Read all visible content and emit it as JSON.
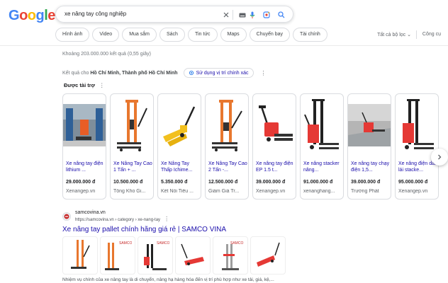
{
  "logo": {
    "text": "Google",
    "letters": [
      "G",
      "o",
      "o",
      "g",
      "l",
      "e"
    ]
  },
  "search": {
    "query": "xe nâng tay công nghiệp"
  },
  "chips": [
    "Hình ảnh",
    "Video",
    "Mua sắm",
    "Sách",
    "Tin tức",
    "Maps",
    "Chuyến bay",
    "Tài chính"
  ],
  "filters_label": "Tất cả bộ lọc",
  "tools_label": "Công cụ",
  "stats": "Khoảng 203.000.000 kết quả (0,55 giây)",
  "location": {
    "prefix": "Kết quả cho",
    "place": "Hồ Chí Minh, Thành phố Hồ Chí Minh",
    "button": "Sử dụng vị trí chính xác"
  },
  "sponsored": {
    "label": "Được tài trợ"
  },
  "products": [
    {
      "title": "Xe nâng tay điện lithium ...",
      "price": "29.000.000 đ",
      "shop": "Xenangep.vn",
      "img": "warehouse-photo"
    },
    {
      "title": "Xe Nâng Tay Cao 1 Tấn + ...",
      "price": "10.500.000 đ",
      "shop": "Tổng Kho Gi...",
      "img": "orange-stacker"
    },
    {
      "title": "Xe Nâng Tay Thấp Ichime...",
      "price": "5.350.000 đ",
      "shop": "Kết Nối Tiêu ...",
      "img": "yellow-pallet-jack"
    },
    {
      "title": "Xe Nâng Tay Cao 2 Tấn -...",
      "price": "12.500.000 đ",
      "shop": "Giảm Giá Tr...",
      "img": "orange-stacker"
    },
    {
      "title": "Xe nâng tay điện EP 1.5 t...",
      "price": "39.000.000 đ",
      "shop": "Xenangep.vn",
      "img": "red-electric-jack"
    },
    {
      "title": "Xe nâng stacker nâng...",
      "price": "91.000.000 đ",
      "shop": "xenanghang...",
      "img": "black-red-stacker"
    },
    {
      "title": "Xe nâng tay chạy điện 1,5...",
      "price": "39.000.000 đ",
      "shop": "Trường Phát",
      "img": "warehouse-floor"
    },
    {
      "title": "Xe nâng điện dắt lái stacke...",
      "price": "95.000.000 đ",
      "shop": "Xenangep.vn",
      "img": "black-red-stacker"
    }
  ],
  "result": {
    "site_name": "samcovina.vn",
    "url": "https://samcovina.vn › category › xe-nang-tay",
    "title": "Xe nâng tay pallet chính hãng giá rẻ | SAMCO VINA",
    "snippet": "Nhiệm vụ chính của xe nâng tay là di chuyển, nâng hạ hàng hóa đến vị trí phù hợp như xe tải, giá, kệ,...",
    "brand": "SAMCO"
  },
  "colors": {
    "link": "#1a0dab",
    "orange": "#e8772e",
    "red": "#e53935",
    "yellow": "#f2c01e"
  }
}
